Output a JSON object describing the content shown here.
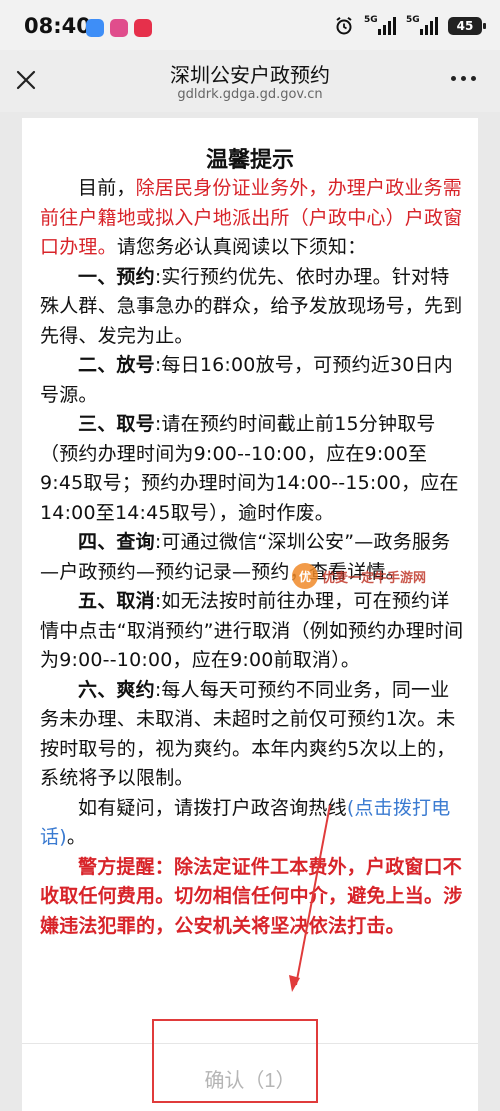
{
  "status_bar": {
    "time": "08:40",
    "network_label_1": "5G",
    "network_label_2": "5G",
    "battery": "45"
  },
  "nav": {
    "title": "深圳公安户政预约",
    "url": "gdldrk.gdga.gd.gov.cn"
  },
  "modal": {
    "title": "温馨提示",
    "intro": {
      "prefix": "目前，",
      "highlight": "除居民身份证业务外，办理户政业务需前往户籍地或拟入户地派出所（户政中心）户政窗口办理。",
      "suffix": "请您务必认真阅读以下须知："
    },
    "items": [
      {
        "label": "一、预约",
        "text": ":实行预约优先、依时办理。针对特殊人群、急事急办的群众，给予发放现场号，先到先得、发完为止。"
      },
      {
        "label": "二、放号",
        "text": ":每日16:00放号，可预约近30日内号源。"
      },
      {
        "label": "三、取号",
        "text": ":请在预约时间截止前15分钟取号（预约办理时间为9:00--10:00，应在9:00至9:45取号；预约办理时间为14:00--15:00，应在14:00至14:45取号），逾时作废。"
      },
      {
        "label": "四、查询",
        "text": ":可通过微信“深圳公安”—政务服务—户政预约—预约记录—预约，查看详情。"
      },
      {
        "label": "五、取消",
        "text": ":如无法按时前往办理，可在预约详情中点击“取消预约”进行取消（例如预约办理时间为9:00--10:00，应在9:00前取消）。"
      },
      {
        "label": "六、爽约",
        "text": ":每人每天可预约不同业务，同一业务未办理、未取消、未超时之前仅可预约1次。未按时取号的，视为爽约。本年内爽约5次以上的，系统将予以限制。"
      }
    ],
    "hotline": {
      "text": "如有疑问，请拨打户政咨询热线",
      "link": "(点击拨打电话)",
      "end": "。"
    },
    "warning": {
      "text": "警方提醒：除法定证件工本费外，户政窗口不收取任何费用。切勿相信任何中介，避免上当。涉嫌违法犯罪的，公安机关将坚决依法打击。"
    },
    "confirm_label": "确认（1）"
  },
  "watermark": {
    "logo": "优",
    "text": "优麦一定牛手游网"
  },
  "colors": {
    "highlight_red": "#d8242a",
    "link_blue": "#3b7bd1",
    "annotation_red": "#e03b3b"
  }
}
